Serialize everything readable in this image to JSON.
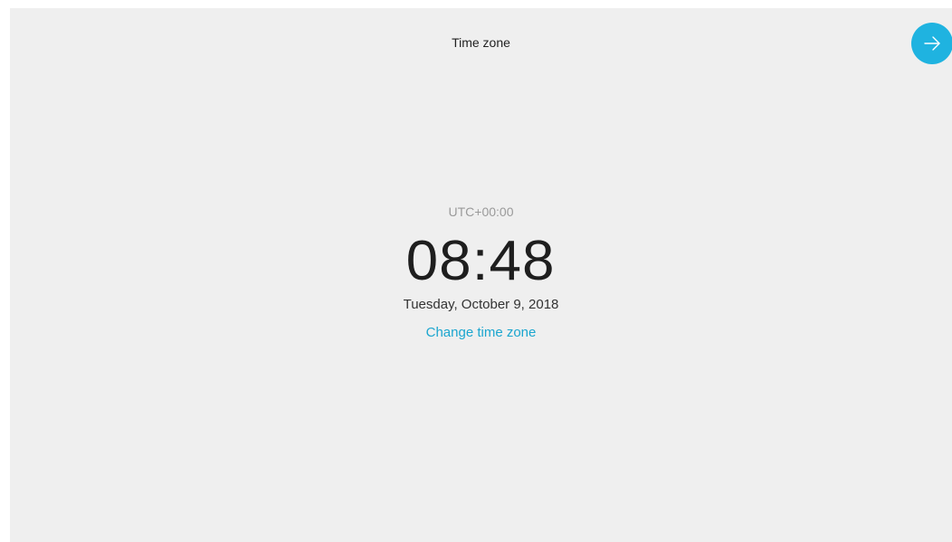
{
  "header": {
    "title": "Time zone"
  },
  "next_button": {
    "icon": "arrow-right-icon",
    "color": "#1fb3e0"
  },
  "clock": {
    "utc_offset": "UTC+00:00",
    "time": "08:48",
    "date": "Tuesday, October 9, 2018",
    "change_link": "Change time zone"
  },
  "colors": {
    "background": "#efefef",
    "accent": "#1ba6cf"
  }
}
